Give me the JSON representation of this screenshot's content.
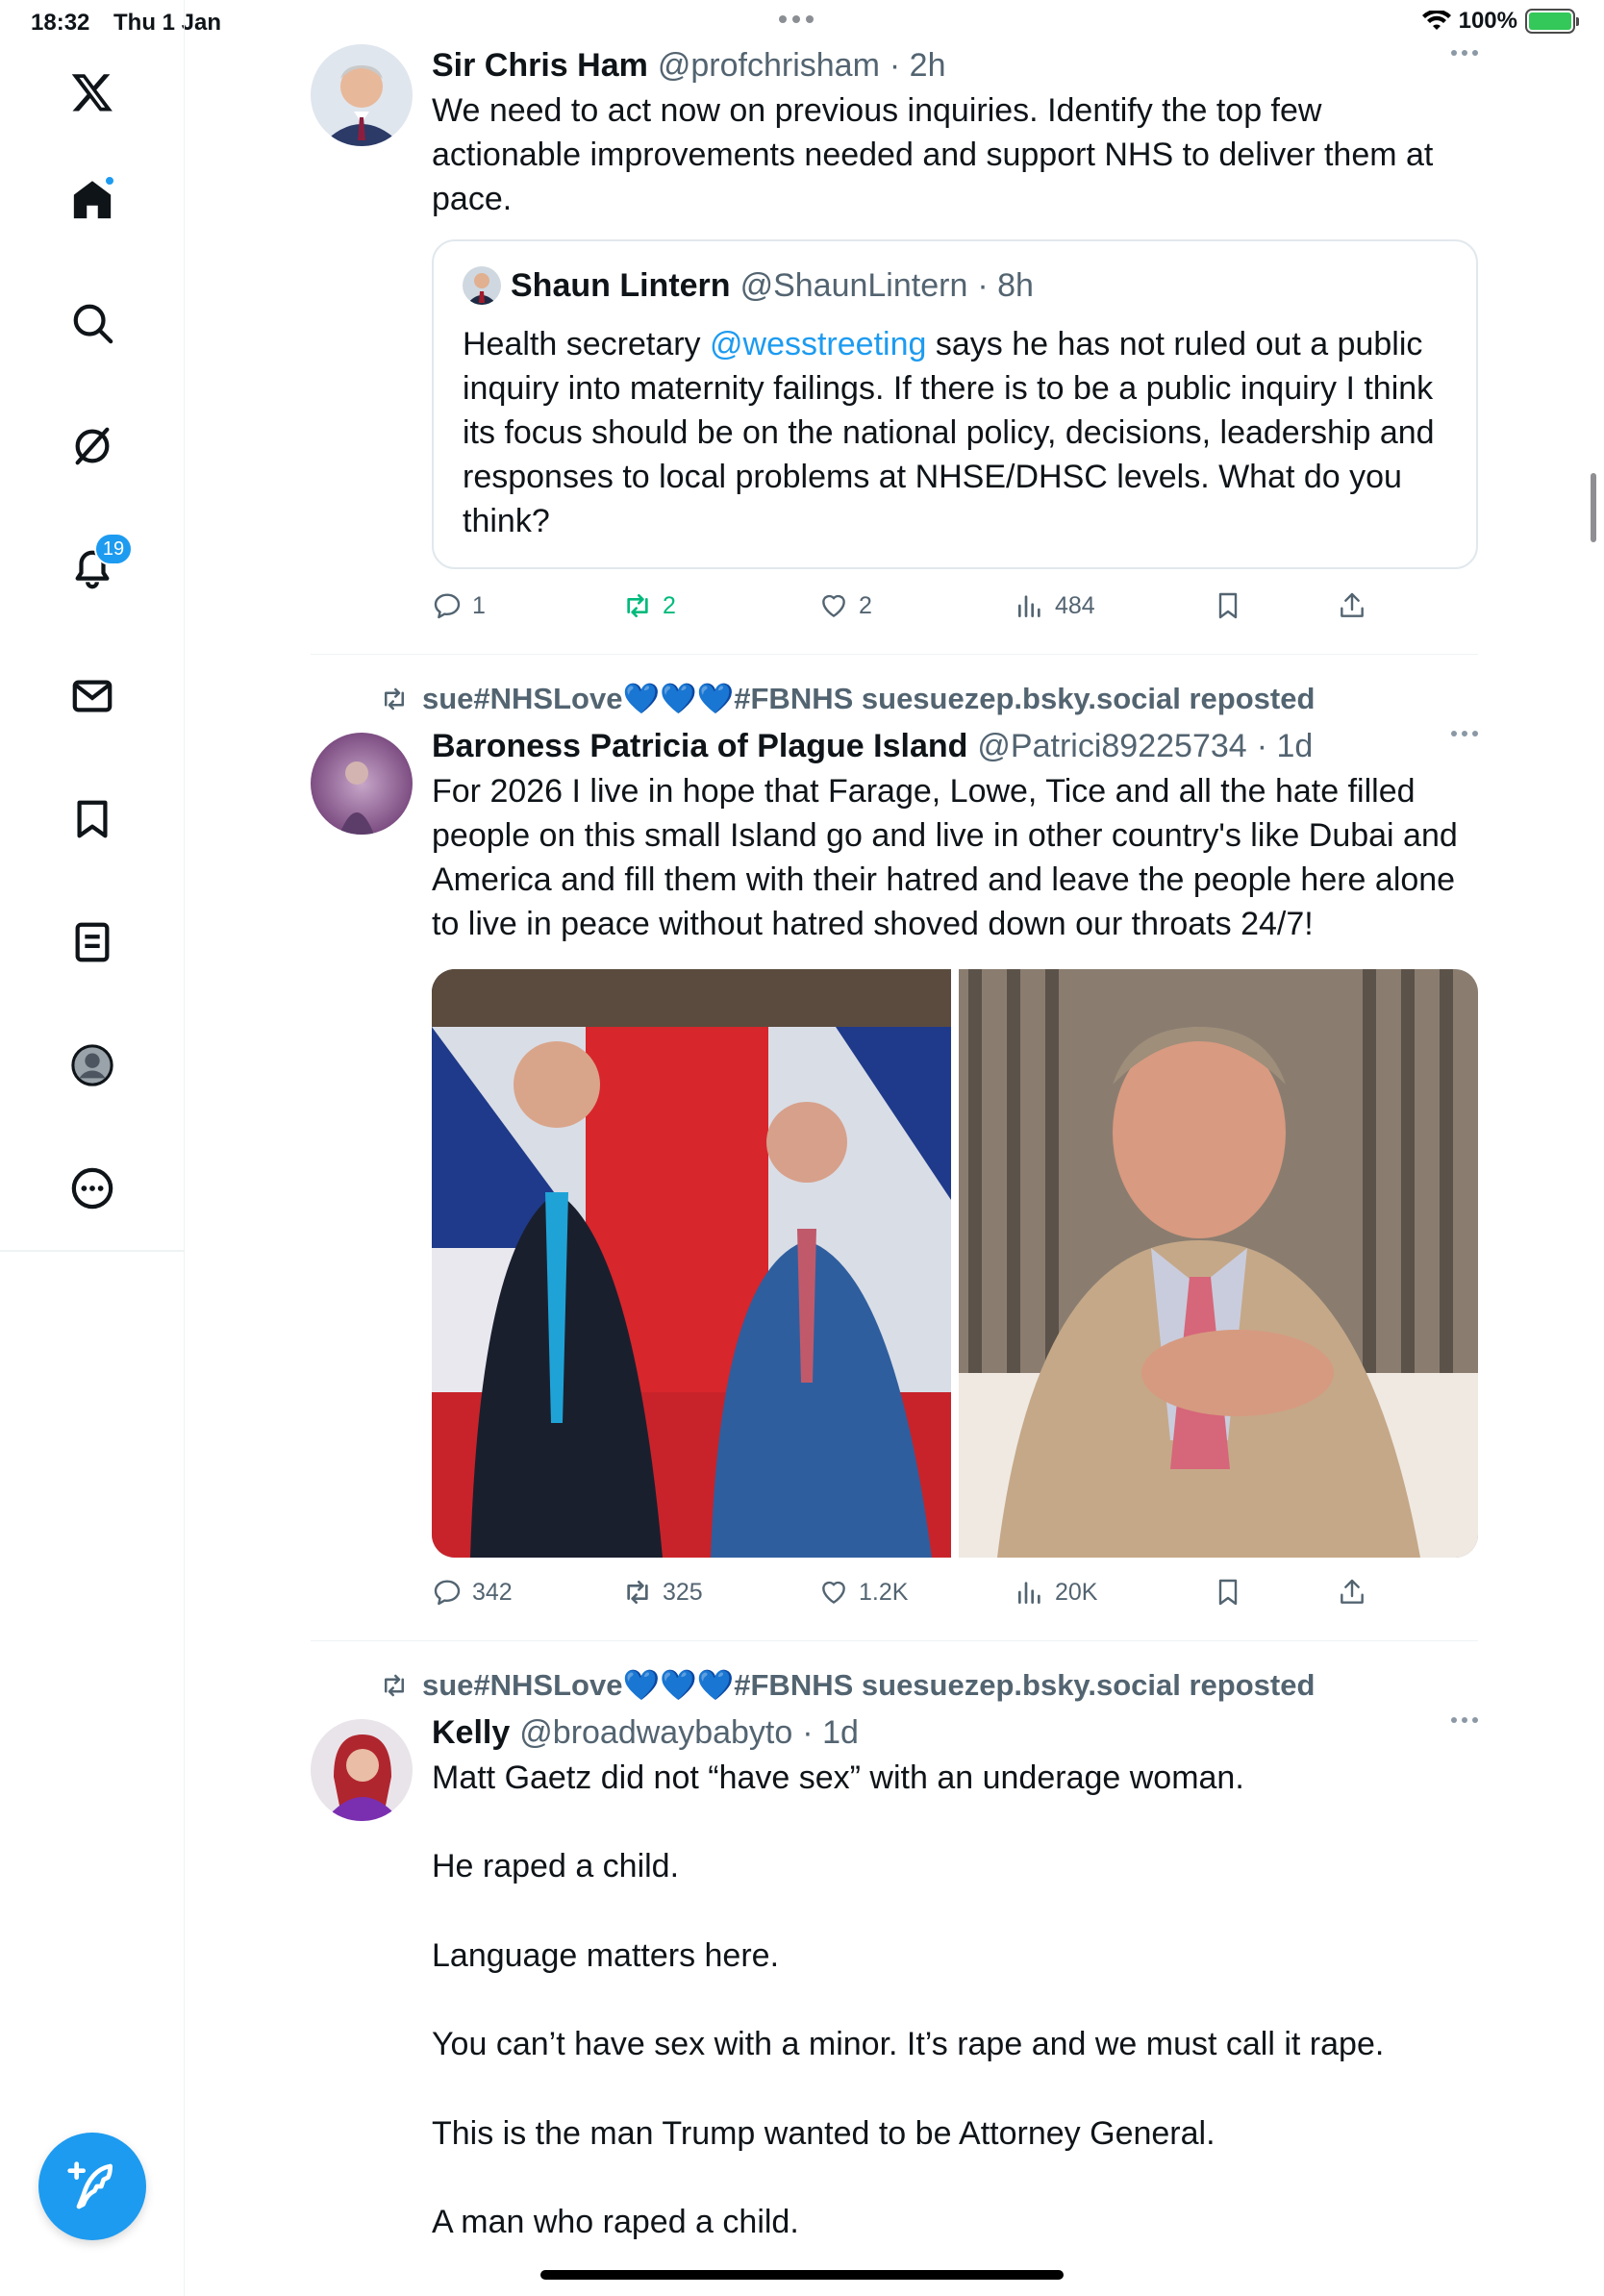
{
  "status_bar": {
    "time": "18:32",
    "date": "Thu 1 Jan",
    "battery": "100%",
    "battery_level": 1.0
  },
  "sidebar": {
    "items": [
      {
        "name": "x-logo",
        "icon": "x-logo-icon"
      },
      {
        "name": "home",
        "icon": "home-icon",
        "has_dot": true
      },
      {
        "name": "search",
        "icon": "search-icon"
      },
      {
        "name": "grok",
        "icon": "grok-icon"
      },
      {
        "name": "notifications",
        "icon": "bell-icon",
        "badge": "19"
      },
      {
        "name": "messages",
        "icon": "envelope-icon"
      },
      {
        "name": "bookmarks",
        "icon": "bookmark-icon"
      },
      {
        "name": "lists",
        "icon": "list-icon"
      },
      {
        "name": "profile",
        "icon": "profile-icon"
      },
      {
        "name": "more",
        "icon": "more-circle-icon"
      }
    ],
    "compose_icon": "compose-icon"
  },
  "colors": {
    "accent": "#1d9bf0",
    "repost_green": "#00ba7c",
    "text_secondary": "#536471"
  },
  "tweets": [
    {
      "name": "Sir Chris Ham",
      "handle": "@profchrisham",
      "time": "· 2h",
      "text": "We need to act now on previous inquiries. Identify the top few actionable improvements needed and support NHS to deliver them at pace.",
      "quote": {
        "name": "Shaun Lintern",
        "handle": "@ShaunLintern",
        "time": "· 8h",
        "text_before": "Health secretary ",
        "mention": "@wesstreeting",
        "text_after": " says he has not ruled out a public inquiry into maternity failings. If there is to be a public inquiry I think its focus should be on the national policy, decisions, leadership and responses to local problems at NHSE/DHSC levels. What do you think?"
      },
      "stats": {
        "replies": "1",
        "reposts": "2",
        "likes": "2",
        "views": "484"
      }
    },
    {
      "repost_label": "sue#NHSLove💙💙💙#FBNHS suesuezep.bsky.social reposted",
      "name": "Baroness Patricia of Plague Island",
      "handle": "@Patrici89225734",
      "time": "· 1d",
      "text": "For 2026 I live in hope that Farage, Lowe, Tice and all the hate filled people on this small Island go and live in other country's like Dubai and America and fill them with their hatred and leave the people here alone to live in peace without hatred shoved down our throats 24/7!",
      "stats": {
        "replies": "342",
        "reposts": "325",
        "likes": "1.2K",
        "views": "20K"
      }
    },
    {
      "repost_label": "sue#NHSLove💙💙💙#FBNHS suesuezep.bsky.social reposted",
      "name": "Kelly",
      "handle": "@broadwaybabyto",
      "time": "· 1d",
      "text": "Matt Gaetz did not “have sex” with an underage woman.\n\nHe raped a child.\n\nLanguage matters here.\n\nYou can’t have sex with a minor. It’s rape and we must call it rape.\n\nThis is the man Trump wanted to be Attorney General.\n\nA man who raped a child."
    }
  ]
}
